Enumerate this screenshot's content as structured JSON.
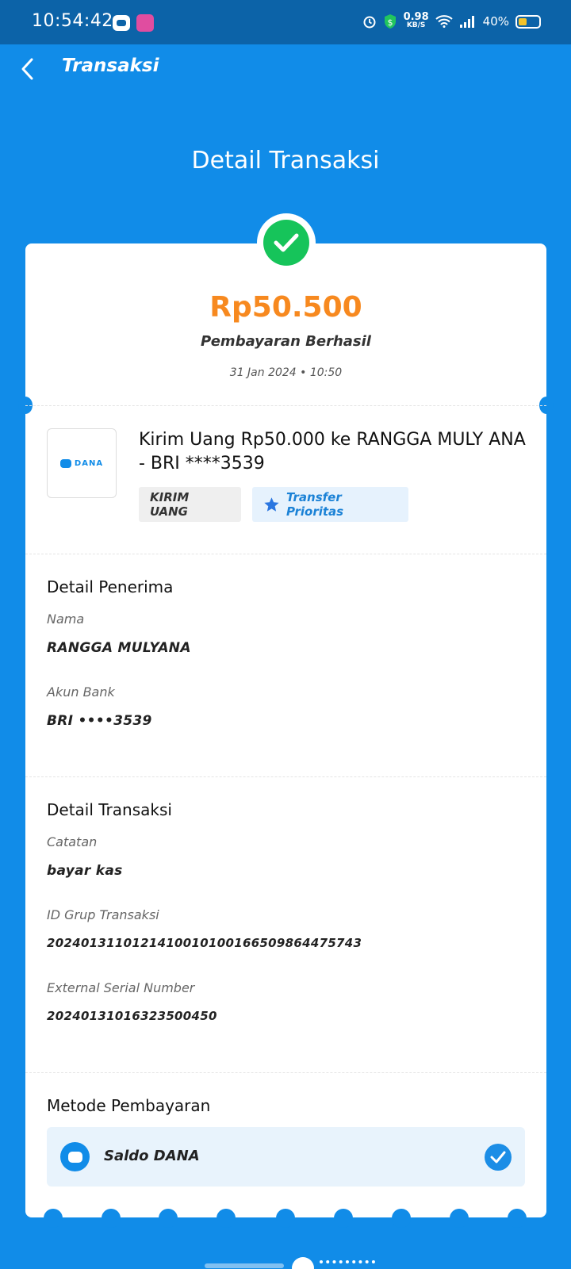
{
  "status_bar": {
    "time": "10:54:42",
    "network_speed": "0.98",
    "network_speed_unit": "KB/S",
    "battery": "40%"
  },
  "app_bar": {
    "title": "Transaksi",
    "back_icon": "chevron-left-icon"
  },
  "page_title": "Detail Transaksi",
  "summary": {
    "amount": "Rp50.500",
    "status": "Pembayaran Berhasil",
    "datetime": "31 Jan 2024 • 10:50",
    "status_color": "#16c45a",
    "amount_color": "#f7891f"
  },
  "merchant": {
    "logo_text": "DANA",
    "description": "Kirim Uang Rp50.000 ke RANGGA MULY ANA - BRI ****3539",
    "tags": {
      "category": "KIRIM UANG",
      "priority": "Transfer Prioritas"
    }
  },
  "recipient": {
    "section_title": "Detail Penerima",
    "name_label": "Nama",
    "name_value": "RANGGA MULYANA",
    "bank_label": "Akun Bank",
    "bank_value": "BRI ••••3539"
  },
  "transaction": {
    "section_title": "Detail Transaksi",
    "note_label": "Catatan",
    "note_value": "bayar kas",
    "group_id_label": "ID Grup Transaksi",
    "group_id_value": "2024013110121410010100166509864475743",
    "serial_label": "External Serial Number",
    "serial_value": "20240131016323500450"
  },
  "payment": {
    "section_title": "Metode Pembayaran",
    "method": "Saldo DANA"
  },
  "colors": {
    "background": "#118ce8",
    "status_bar": "#0c63a8",
    "accent": "#1b82d6"
  }
}
